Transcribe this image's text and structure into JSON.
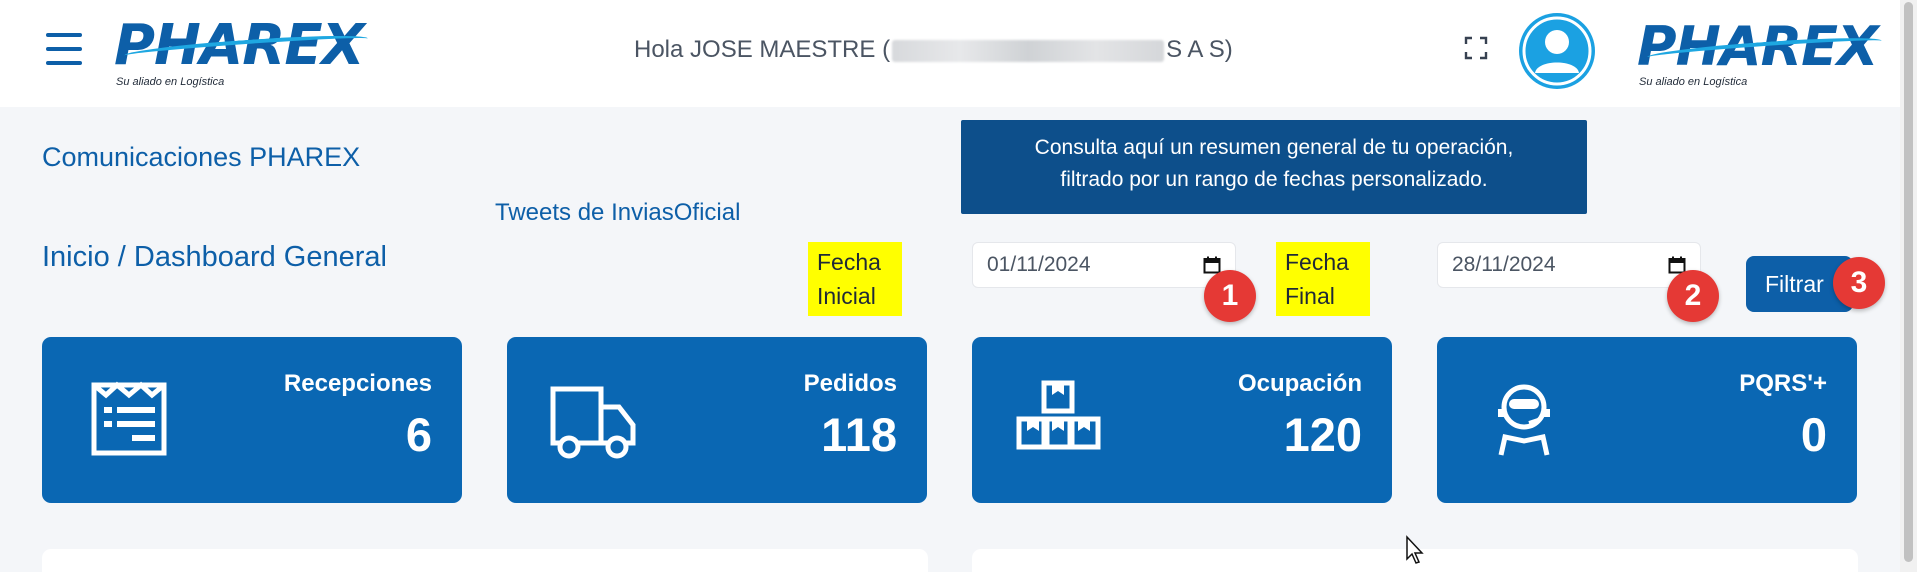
{
  "header": {
    "brand": "PHAREX",
    "tagline": "Su aliado en Logística",
    "greeting_prefix": "Hola JOSE MAESTRE (",
    "greeting_suffix": "S A S)"
  },
  "content": {
    "communications_title": "Comunicaciones PHAREX",
    "tweets_link": "Tweets de InviasOficial",
    "breadcrumb": "Inicio / Dashboard General",
    "info_line1": "Consulta aquí un resumen general de tu operación,",
    "info_line2": "filtrado por un rango de fechas personalizado."
  },
  "filters": {
    "start_label_line1": "Fecha",
    "start_label_line2": "Inicial",
    "start_date": "01/11/2024",
    "end_label_line1": "Fecha",
    "end_label_line2": "Final",
    "end_date": "28/11/2024",
    "filter_button": "Filtrar",
    "badges": [
      "1",
      "2",
      "3"
    ]
  },
  "stats": [
    {
      "label": "Recepciones",
      "value": "6",
      "icon": "receipt-list-icon"
    },
    {
      "label": "Pedidos",
      "value": "118",
      "icon": "truck-icon"
    },
    {
      "label": "Ocupación",
      "value": "120",
      "icon": "boxes-icon"
    },
    {
      "label": "PQRS'+",
      "value": "0",
      "icon": "support-agent-icon"
    }
  ],
  "colors": {
    "primary": "#0a67b3",
    "brand_blue": "#0d5fa8",
    "accent_cyan": "#1ba1e2",
    "info_box": "#0d4f8b",
    "highlight": "#ffff00",
    "badge_red": "#e53935"
  }
}
